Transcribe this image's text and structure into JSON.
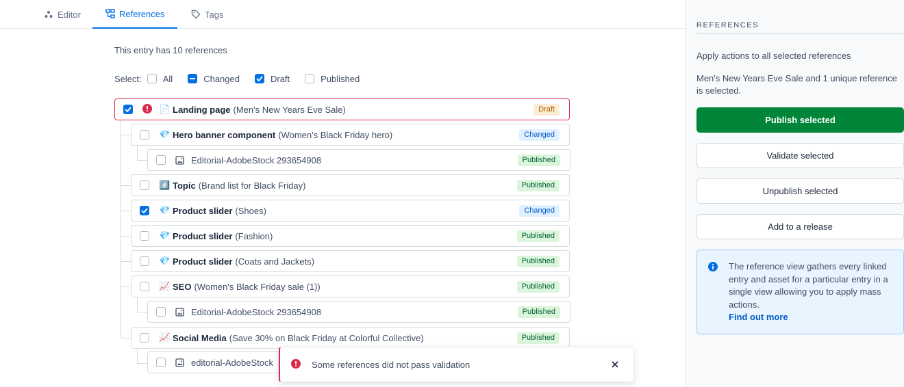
{
  "tabs": [
    {
      "label": "Editor",
      "icon": "editor-icon"
    },
    {
      "label": "References",
      "icon": "references-icon",
      "active": true
    },
    {
      "label": "Tags",
      "icon": "tag-icon"
    }
  ],
  "intro": "This entry has 10 references",
  "select": {
    "label": "Select:",
    "options": [
      {
        "label": "All",
        "state": "unchecked"
      },
      {
        "label": "Changed",
        "state": "indeterminate"
      },
      {
        "label": "Draft",
        "state": "checked"
      },
      {
        "label": "Published",
        "state": "unchecked"
      }
    ]
  },
  "references": [
    {
      "type": "entry",
      "emoji": "📄",
      "title": "Landing page",
      "subtitle": "(Men's New Years Eve Sale)",
      "status": "Draft",
      "checked": true,
      "error": true
    },
    {
      "type": "entry",
      "emoji": "💎",
      "title": "Hero banner component",
      "subtitle": "(Women's Black Friday hero)",
      "status": "Changed",
      "checked": false
    },
    {
      "type": "asset",
      "name": "Editorial-AdobeStock 293654908",
      "status": "Published",
      "checked": false
    },
    {
      "type": "entry",
      "emoji": "#️⃣",
      "title": "Topic",
      "subtitle": "(Brand list for Black Friday)",
      "status": "Published",
      "checked": false
    },
    {
      "type": "entry",
      "emoji": "💎",
      "title": "Product slider",
      "subtitle": "(Shoes)",
      "status": "Changed",
      "checked": true
    },
    {
      "type": "entry",
      "emoji": "💎",
      "title": "Product slider",
      "subtitle": "(Fashion)",
      "status": "Published",
      "checked": false
    },
    {
      "type": "entry",
      "emoji": "💎",
      "title": "Product slider",
      "subtitle": "(Coats and Jackets)",
      "status": "Published",
      "checked": false
    },
    {
      "type": "entry",
      "emoji": "📈",
      "title": "SEO",
      "subtitle": "(Women's Black Friday sale (1))",
      "status": "Published",
      "checked": false
    },
    {
      "type": "asset",
      "name": "Editorial-AdobeStock 293654908",
      "status": "Published",
      "checked": false
    },
    {
      "type": "entry",
      "emoji": "📈",
      "title": "Social Media",
      "subtitle": "(Save 30% on Black Friday at Colorful Collective)",
      "status": "Published",
      "checked": false
    },
    {
      "type": "asset",
      "name": "editorial-AdobeStock",
      "status": "",
      "checked": false
    }
  ],
  "toast": {
    "message": "Some references did not pass validation"
  },
  "sidebar": {
    "heading": "REFERENCES",
    "apply_text": "Apply actions to all selected references",
    "selection_text": "Men's New Years Eve Sale and 1 unique reference is selected.",
    "buttons": {
      "publish": "Publish selected",
      "validate": "Validate selected",
      "unpublish": "Unpublish selected",
      "release": "Add to a release"
    },
    "note": {
      "text": "The reference view gathers every linked entry and asset for a particular entry in a single view allowing you to apply mass actions.",
      "link": "Find out more"
    }
  },
  "colors": {
    "accent": "#036fe3",
    "primary_button": "#008539",
    "error": "#da294a"
  }
}
